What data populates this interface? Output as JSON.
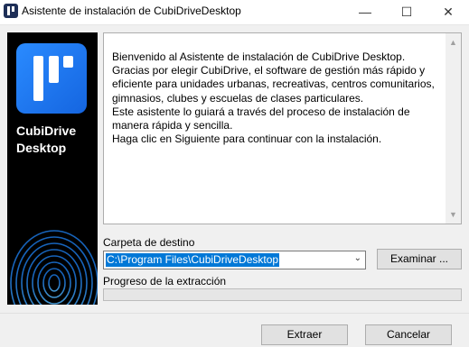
{
  "window": {
    "title": "Asistente de instalación de CubiDriveDesktop",
    "controls": {
      "minimize": "—",
      "maximize": "☐",
      "close": "✕"
    }
  },
  "sidebar": {
    "brand_line1": "CubiDrive",
    "brand_line2": "Desktop",
    "logo_color": "#1e7cff",
    "background": "#000000"
  },
  "info": {
    "text": "Bienvenido al Asistente de instalación de CubiDrive Desktop.\nGracias por elegir CubiDrive, el software de gestión más rápido y eficiente para unidades urbanas, recreativas, centros comunitarios, gimnasios, clubes y escuelas de clases particulares.\nEste asistente lo guiará a través del proceso de instalación de manera rápida y sencilla.\nHaga clic en Siguiente para continuar con la instalación."
  },
  "destination": {
    "label": "Carpeta de destino",
    "value": "C:\\Program Files\\CubiDriveDesktop",
    "browse_label": "Examinar ..."
  },
  "progress": {
    "label": "Progreso de la extracción",
    "fraction": 0
  },
  "actions": {
    "extract_label": "Extraer",
    "cancel_label": "Cancelar"
  }
}
